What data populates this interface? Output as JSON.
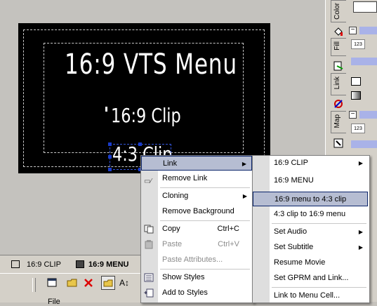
{
  "right_panel": {
    "tabs": [
      "Color",
      "Fill",
      "Link",
      "Map"
    ],
    "number_boxes": [
      "123",
      "123"
    ]
  },
  "canvas": {
    "menu_title": "16:9 VTS Menu",
    "buttons": [
      "16:9 Clip",
      "4:3 Clip"
    ]
  },
  "bottom_tabs": [
    "16:9 CLIP",
    "16:9 MENU"
  ],
  "toolbar": {
    "bottom_label": "File"
  },
  "context_menu": {
    "items": [
      {
        "label": "Link",
        "shortcut": "",
        "submenu": true,
        "disabled": false,
        "highlighted": true
      },
      {
        "label": "Remove Link",
        "shortcut": "",
        "submenu": false,
        "disabled": false
      },
      {
        "label": "Cloning",
        "shortcut": "",
        "submenu": true,
        "disabled": false
      },
      {
        "label": "Remove Background",
        "shortcut": "",
        "submenu": false,
        "disabled": false
      },
      {
        "label": "Copy",
        "shortcut": "Ctrl+C",
        "submenu": false,
        "disabled": false
      },
      {
        "label": "Paste",
        "shortcut": "Ctrl+V",
        "submenu": false,
        "disabled": true
      },
      {
        "label": "Paste Attributes...",
        "shortcut": "",
        "submenu": false,
        "disabled": true
      },
      {
        "label": "Show Styles",
        "shortcut": "",
        "submenu": false,
        "disabled": false
      },
      {
        "label": "Add to Styles",
        "shortcut": "",
        "submenu": false,
        "disabled": false
      }
    ]
  },
  "link_submenu": {
    "items": [
      {
        "label": "16:9 CLIP",
        "submenu": true
      },
      {
        "label": "16:9 MENU",
        "submenu": false
      },
      {
        "label": "16:9 menu to 4:3 clip",
        "submenu": false,
        "highlighted": true
      },
      {
        "label": "4:3 clip to 16:9 menu",
        "submenu": false
      },
      {
        "label": "Set Audio",
        "submenu": true
      },
      {
        "label": "Set Subtitle",
        "submenu": true
      },
      {
        "label": "Resume Movie",
        "submenu": false
      },
      {
        "label": "Set GPRM and Link...",
        "submenu": false
      },
      {
        "label": "Link to Menu Cell...",
        "submenu": false
      }
    ]
  },
  "colors": {
    "highlight": "#b6bdd2",
    "highlight_border": "#0a246a",
    "selection": "#1a3ccc",
    "accent_bar": "#a9b2e8"
  }
}
